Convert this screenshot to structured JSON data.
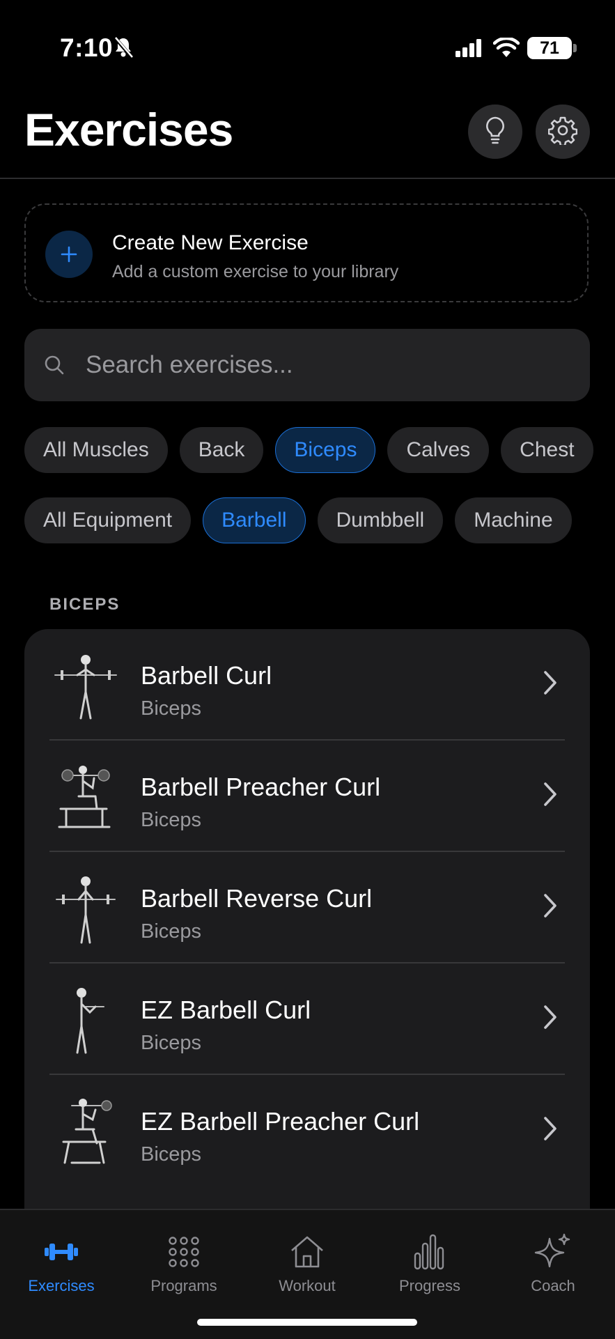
{
  "status": {
    "time": "7:10",
    "battery": "71"
  },
  "header": {
    "title": "Exercises"
  },
  "create": {
    "title": "Create New Exercise",
    "subtitle": "Add a custom exercise to your library"
  },
  "search": {
    "placeholder": "Search exercises..."
  },
  "muscle_filters": [
    {
      "label": "All Muscles",
      "active": false
    },
    {
      "label": "Back",
      "active": false
    },
    {
      "label": "Biceps",
      "active": true
    },
    {
      "label": "Calves",
      "active": false
    },
    {
      "label": "Chest",
      "active": false
    }
  ],
  "equipment_filters": [
    {
      "label": "All Equipment",
      "active": false
    },
    {
      "label": "Barbell",
      "active": true
    },
    {
      "label": "Dumbbell",
      "active": false
    },
    {
      "label": "Machine",
      "active": false
    }
  ],
  "section": {
    "label": "BICEPS"
  },
  "exercises": [
    {
      "name": "Barbell Curl",
      "muscle": "Biceps"
    },
    {
      "name": "Barbell Preacher Curl",
      "muscle": "Biceps"
    },
    {
      "name": "Barbell Reverse Curl",
      "muscle": "Biceps"
    },
    {
      "name": "EZ Barbell Curl",
      "muscle": "Biceps"
    },
    {
      "name": "EZ Barbell Preacher Curl",
      "muscle": "Biceps"
    }
  ],
  "tabs": [
    {
      "label": "Exercises",
      "icon": "dumbbell-icon",
      "active": true
    },
    {
      "label": "Programs",
      "icon": "grid-dots-icon",
      "active": false
    },
    {
      "label": "Workout",
      "icon": "home-icon",
      "active": false
    },
    {
      "label": "Progress",
      "icon": "bar-chart-icon",
      "active": false
    },
    {
      "label": "Coach",
      "icon": "sparkles-icon",
      "active": false
    }
  ],
  "colors": {
    "accent": "#2f8bff",
    "chip_active_bg": "#0b2746",
    "card_bg": "#1c1c1e"
  }
}
